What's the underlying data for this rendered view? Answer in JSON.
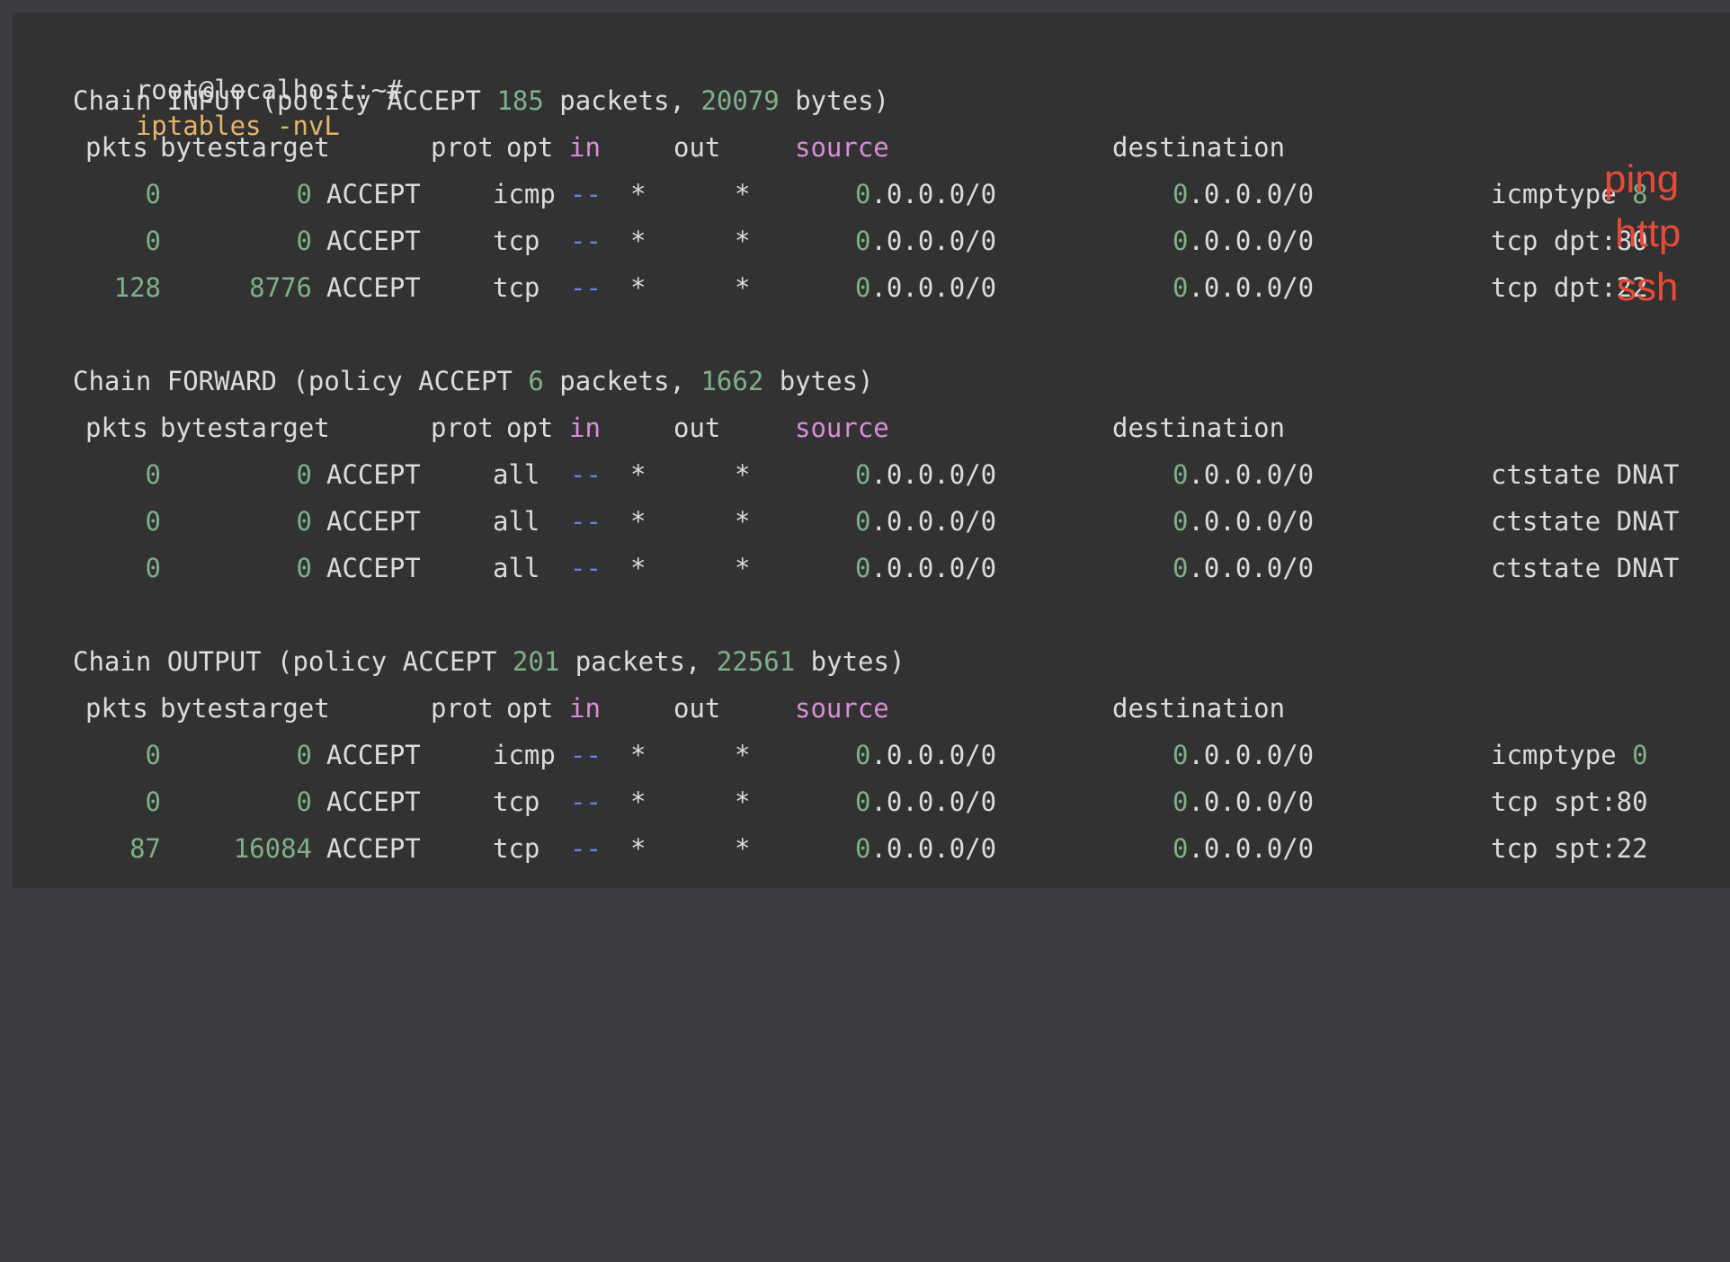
{
  "prompt": {
    "user_host": "root@localhost:~#",
    "command": "iptables -nvL"
  },
  "headers": {
    "pkts": "pkts",
    "bytes": "bytes",
    "target": "target",
    "prot": "prot",
    "opt": "opt",
    "in": "in",
    "out": "out",
    "source": "source",
    "destination": "destination"
  },
  "chains": [
    {
      "name": "INPUT",
      "policy": "ACCEPT",
      "packets": "185",
      "bytes": "20079",
      "rules": [
        {
          "pkts": "0",
          "bytes": "0",
          "target": "ACCEPT",
          "prot": "icmp",
          "opt": "--",
          "in": "*",
          "out": "*",
          "source": "0.0.0.0/0",
          "destination": "0.0.0.0/0",
          "extra": "icmptype",
          "extra_num": "8"
        },
        {
          "pkts": "0",
          "bytes": "0",
          "target": "ACCEPT",
          "prot": "tcp",
          "opt": "--",
          "in": "*",
          "out": "*",
          "source": "0.0.0.0/0",
          "destination": "0.0.0.0/0",
          "extra": "tcp dpt:80",
          "extra_num": ""
        },
        {
          "pkts": "128",
          "bytes": "8776",
          "target": "ACCEPT",
          "prot": "tcp",
          "opt": "--",
          "in": "*",
          "out": "*",
          "source": "0.0.0.0/0",
          "destination": "0.0.0.0/0",
          "extra": "tcp dpt:22",
          "extra_num": ""
        }
      ]
    },
    {
      "name": "FORWARD",
      "policy": "ACCEPT",
      "packets": "6",
      "bytes": "1662",
      "rules": [
        {
          "pkts": "0",
          "bytes": "0",
          "target": "ACCEPT",
          "prot": "all",
          "opt": "--",
          "in": "*",
          "out": "*",
          "source": "0.0.0.0/0",
          "destination": "0.0.0.0/0",
          "extra": "ctstate DNAT",
          "extra_num": ""
        },
        {
          "pkts": "0",
          "bytes": "0",
          "target": "ACCEPT",
          "prot": "all",
          "opt": "--",
          "in": "*",
          "out": "*",
          "source": "0.0.0.0/0",
          "destination": "0.0.0.0/0",
          "extra": "ctstate DNAT",
          "extra_num": ""
        },
        {
          "pkts": "0",
          "bytes": "0",
          "target": "ACCEPT",
          "prot": "all",
          "opt": "--",
          "in": "*",
          "out": "*",
          "source": "0.0.0.0/0",
          "destination": "0.0.0.0/0",
          "extra": "ctstate DNAT",
          "extra_num": ""
        }
      ]
    },
    {
      "name": "OUTPUT",
      "policy": "ACCEPT",
      "packets": "201",
      "bytes": "22561",
      "rules": [
        {
          "pkts": "0",
          "bytes": "0",
          "target": "ACCEPT",
          "prot": "icmp",
          "opt": "--",
          "in": "*",
          "out": "*",
          "source": "0.0.0.0/0",
          "destination": "0.0.0.0/0",
          "extra": "icmptype",
          "extra_num": "0"
        },
        {
          "pkts": "0",
          "bytes": "0",
          "target": "ACCEPT",
          "prot": "tcp",
          "opt": "--",
          "in": "*",
          "out": "*",
          "source": "0.0.0.0/0",
          "destination": "0.0.0.0/0",
          "extra": "tcp spt:80",
          "extra_num": ""
        },
        {
          "pkts": "87",
          "bytes": "16084",
          "target": "ACCEPT",
          "prot": "tcp",
          "opt": "--",
          "in": "*",
          "out": "*",
          "source": "0.0.0.0/0",
          "destination": "0.0.0.0/0",
          "extra": "tcp spt:22",
          "extra_num": ""
        }
      ]
    }
  ],
  "annotations": [
    "ping",
    "http",
    "ssh"
  ],
  "colors": {
    "background": "#323232",
    "text": "#dcdcdc",
    "number": "#7fb08a",
    "in_source_header": "#d98ed8",
    "opt_dashes": "#6d7fe0",
    "command": "#e6b56a",
    "annotation": "#e84a38"
  }
}
